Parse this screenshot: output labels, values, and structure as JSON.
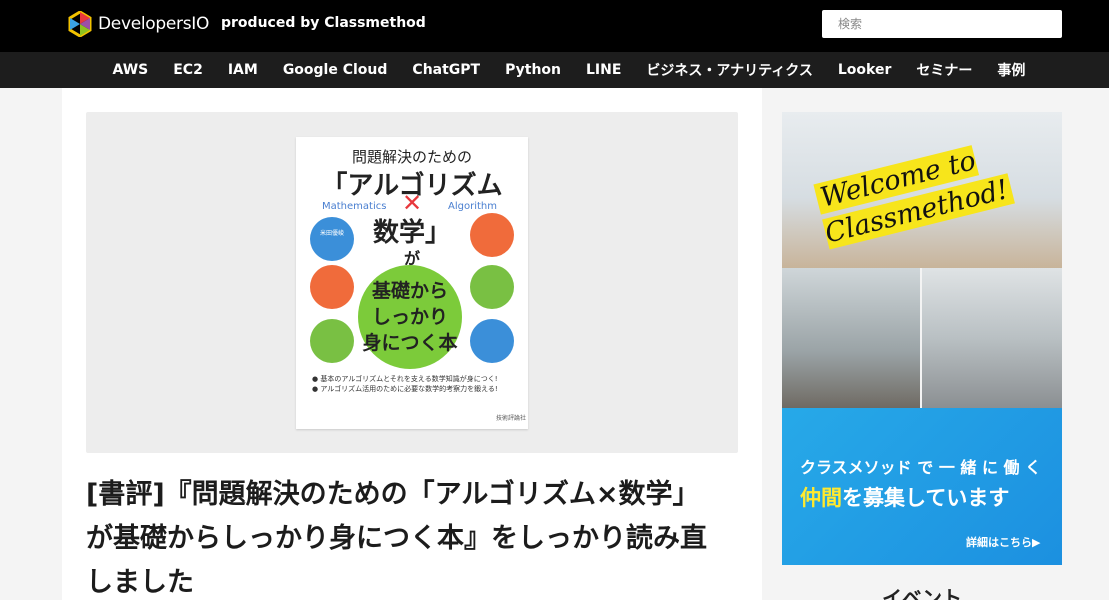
{
  "header": {
    "logo_text": "DevelopersIO",
    "tagline": "produced by Classmethod",
    "search_placeholder": "検索"
  },
  "nav": {
    "items": [
      "AWS",
      "EC2",
      "IAM",
      "Google Cloud",
      "ChatGPT",
      "Python",
      "LINE",
      "ビジネス・アナリティクス",
      "Looker",
      "セミナー",
      "事例"
    ]
  },
  "article": {
    "title": "[書評]『問題解決のための「アルゴリズム×数学」が基礎からしっかり身につく本』をしっかり読み直しました",
    "book_cover": {
      "line1": "問題解決のための",
      "line2": "「アルゴリズム",
      "line3": "数学」",
      "subtitle_left": "Mathematics",
      "subtitle_right": "Algorithm",
      "ga": "が",
      "circle_lines": [
        "基礎から",
        "しっかり",
        "身につく本"
      ],
      "bullet1": "● 基本のアルゴリズムとそれを支える数学知識が身につく!",
      "bullet2": "● アルゴリズム活用のために必要な数学的考察力を鍛える!",
      "author": "米田優峻",
      "footer": "技術評論社"
    }
  },
  "sidebar": {
    "ad": {
      "welcome": "Welcome to Classmethod!",
      "recruit_line1": "クラスメソッド で 一 緒 に 働 く",
      "recruit_hl": "仲間",
      "recruit_rest": "を募集しています",
      "recruit_link": "詳細はこちら▶"
    },
    "event_heading": "イベント"
  },
  "colors": {
    "header_bg": "#000000",
    "nav_bg": "#1d1d1d",
    "page_bg": "#f4f4f4",
    "ad_blue": "#1c90e0",
    "ad_yellow": "#f7e51b"
  }
}
